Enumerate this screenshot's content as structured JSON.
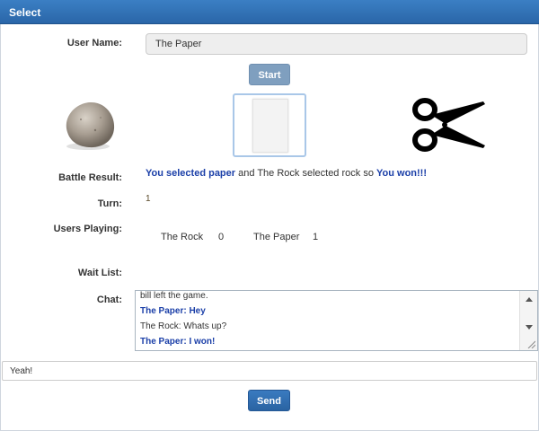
{
  "window": {
    "title": "Select"
  },
  "form": {
    "username_label": "User Name:",
    "username_value": "The Paper",
    "start_label": "Start"
  },
  "choices": {
    "rock_icon": "rock-icon",
    "paper_icon": "paper-icon",
    "scissors_icon": "scissors-icon",
    "selected": "paper"
  },
  "battle": {
    "label": "Battle Result:",
    "part1": "You selected paper",
    "part2": " and The Rock selected rock so ",
    "part3": "You won!!!"
  },
  "turn": {
    "label": "Turn:",
    "value": "1"
  },
  "users_playing": {
    "label": "Users Playing:",
    "players": [
      {
        "name": "The Rock",
        "score": "0"
      },
      {
        "name": "The Paper",
        "score": "1"
      }
    ]
  },
  "wait_list": {
    "label": "Wait List:"
  },
  "chat": {
    "label": "Chat:",
    "messages": [
      {
        "text": "bill left the game.",
        "style": "normal"
      },
      {
        "text": "The Paper: Hey",
        "style": "blue"
      },
      {
        "text": "The Rock: Whats up?",
        "style": "normal"
      },
      {
        "text": "The Paper: I won!",
        "style": "blue"
      }
    ]
  },
  "message_input": {
    "value": "Yeah!"
  },
  "send_label": "Send",
  "colors": {
    "titlebar": "#2f72b8",
    "highlight_text": "#1b3fa8",
    "button_blue": "#2f6fb1"
  }
}
